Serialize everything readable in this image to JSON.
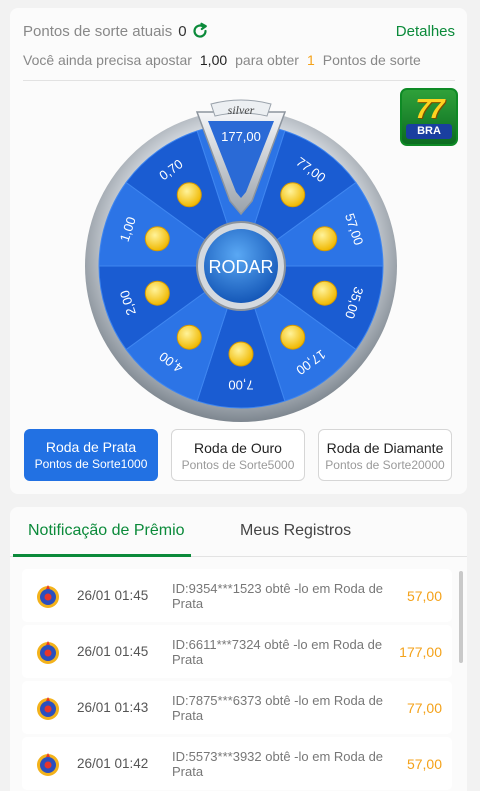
{
  "header": {
    "points_label": "Pontos de sorte atuais",
    "points_value": "0",
    "details_link": "Detalhes",
    "need_text": "Você ainda precisa apostar",
    "need_amount": "1,00",
    "obtain_text": "para obter",
    "obtain_points": "1",
    "points_unit": "Pontos de sorte"
  },
  "wheel": {
    "badge": "silver",
    "spin_label": "RODAR",
    "segments": [
      "177,00",
      "77,00",
      "57,00",
      "35,00",
      "17,00",
      "7,00",
      "4,00",
      "2,00",
      "1,00",
      "0,70"
    ]
  },
  "logo": {
    "number": "77",
    "text": "BRA"
  },
  "tiers": [
    {
      "name": "Roda de Prata",
      "cost": "Pontos de Sorte1000"
    },
    {
      "name": "Roda de Ouro",
      "cost": "Pontos de Sorte5000"
    },
    {
      "name": "Roda de Diamante",
      "cost": "Pontos de Sorte20000"
    }
  ],
  "tabs": [
    "Notificação de Prêmio",
    "Meus Registros"
  ],
  "records": [
    {
      "time": "26/01 01:45",
      "text": "ID:9354***1523 obtê -lo em Roda de Prata",
      "amount": "57,00"
    },
    {
      "time": "26/01 01:45",
      "text": "ID:6611***7324 obtê -lo em Roda de Prata",
      "amount": "177,00"
    },
    {
      "time": "26/01 01:43",
      "text": "ID:7875***6373 obtê -lo em Roda de Prata",
      "amount": "77,00"
    },
    {
      "time": "26/01 01:42",
      "text": "ID:5573***3932 obtê -lo em Roda de Prata",
      "amount": "57,00"
    }
  ],
  "colors": {
    "accent_green": "#0b8a3a",
    "primary_blue": "#2271e3",
    "amount_orange": "#f4a21a"
  }
}
